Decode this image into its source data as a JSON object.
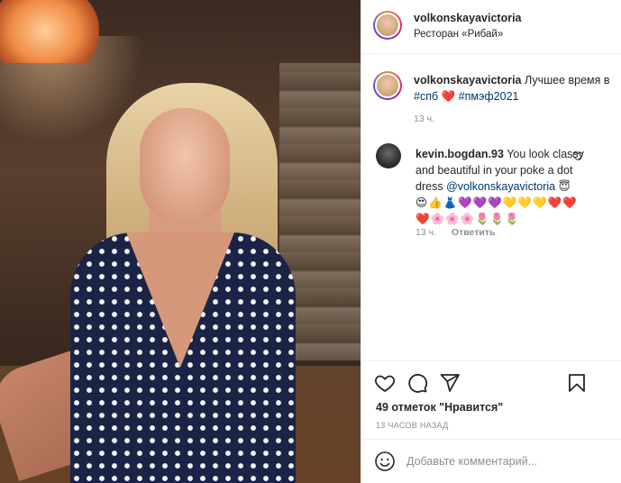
{
  "post": {
    "author": "volkonskayavictoria",
    "location": "Ресторан «Рибай»",
    "image_alt": "photo",
    "caption": {
      "user": "volkonskayavictoria",
      "text": "Лучшее время в",
      "tag1": "#спб",
      "heart": "❤️",
      "tag2": "#пмэф2021",
      "time": "13 ч."
    },
    "comments": [
      {
        "user": "kevin.bogdan.93",
        "text": "You look classy and beautiful in your poke a dot dress",
        "mention": "@volkonskayavictoria",
        "emoji_inline": "😇",
        "emoji_line1": "😍👍👗💜💜💜💛💛💛❤️❤️",
        "emoji_line2": "❤️🌸🌸🌸🌷🌷🌷",
        "time": "13 ч.",
        "reply_label": "Ответить"
      }
    ],
    "likes_text": "49 отметок \"Нравится\"",
    "posted_ago": "13 ЧАСОВ НАЗАД",
    "comment_placeholder": "Добавьте комментарий..."
  },
  "icons": {
    "like": "heart-outline-icon",
    "comment": "comment-bubble-icon",
    "share": "paper-plane-icon",
    "save": "bookmark-icon",
    "emoji": "smiley-icon",
    "comment_like": "small-heart-icon"
  },
  "colors": {
    "link": "#00376b",
    "muted": "#8e8e8e",
    "text": "#262626",
    "border": "#efefef"
  }
}
